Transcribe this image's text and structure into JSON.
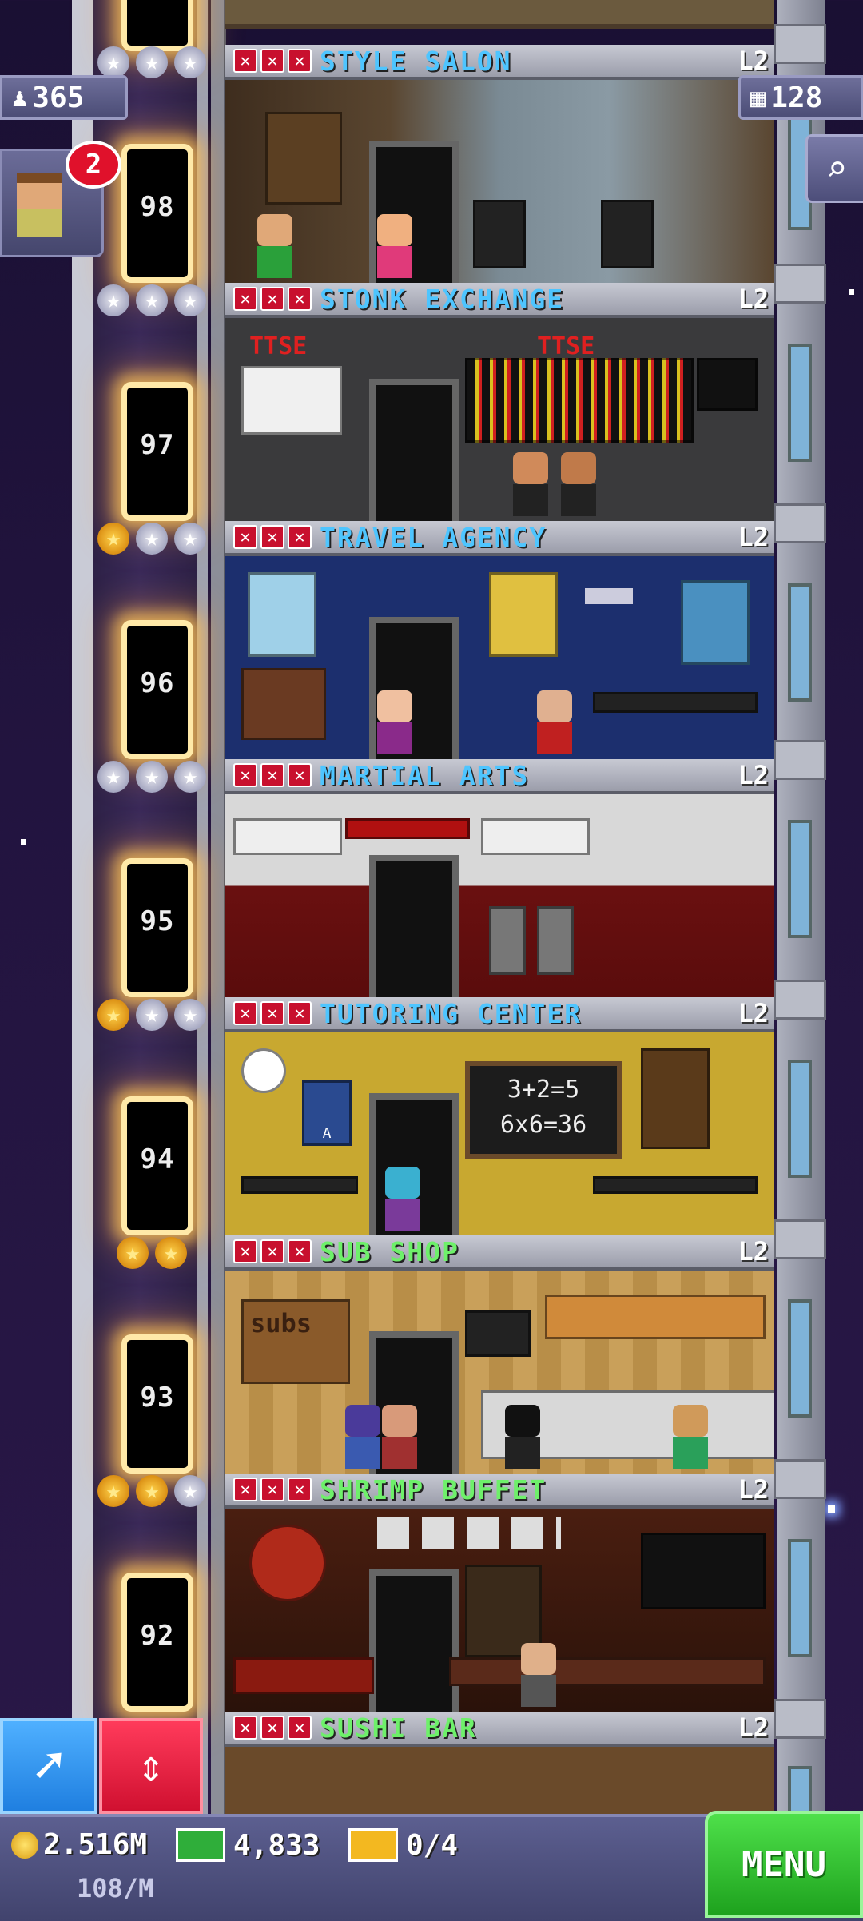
{
  "hud": {
    "population": "365",
    "floors_count": "128",
    "visitor_badge": "2"
  },
  "top_floor": {
    "elevator_number": ""
  },
  "floors": [
    {
      "name": "STYLE SALON",
      "level": "L2",
      "elevator": "98",
      "stars_filled": 0,
      "color": "blue"
    },
    {
      "name": "STONK EXCHANGE",
      "level": "L2",
      "elevator": "97",
      "stars_filled": 0,
      "color": "blue"
    },
    {
      "name": "TRAVEL AGENCY",
      "level": "L2",
      "elevator": "96",
      "stars_filled": 1,
      "color": "blue"
    },
    {
      "name": "MARTIAL ARTS",
      "level": "L2",
      "elevator": "95",
      "stars_filled": 0,
      "color": "blue"
    },
    {
      "name": "TUTORING CENTER",
      "level": "L2",
      "elevator": "94",
      "stars_filled": 1,
      "color": "blue"
    },
    {
      "name": "SUB SHOP",
      "level": "L2",
      "elevator": "93",
      "stars_filled": 2,
      "color": "green"
    },
    {
      "name": "SHRIMP BUFFET",
      "level": "L2",
      "elevator": "92",
      "stars_filled": 2,
      "color": "green"
    },
    {
      "name": "SUSHI BAR",
      "level": "L2",
      "elevator": "",
      "stars_filled": null,
      "color": "green"
    }
  ],
  "room_signs": {
    "stonk_left": "TTSE",
    "stonk_right": "TTSE",
    "tutoring_board_1": "3+2=5",
    "tutoring_board_2": "6x6=36",
    "tutoring_poster": "A",
    "sub_sign": "subs"
  },
  "bottom_bar": {
    "coins": "2.516M",
    "bux": "4,833",
    "tickets": "0/4",
    "rate": "108/M",
    "menu_label": "MENU"
  },
  "colors": {
    "name_blue": "#4ec5ff",
    "name_green": "#6ef06a",
    "cross_red": "#c8102e",
    "menu_green": "#2bc12b",
    "sky": "#1a1033"
  }
}
